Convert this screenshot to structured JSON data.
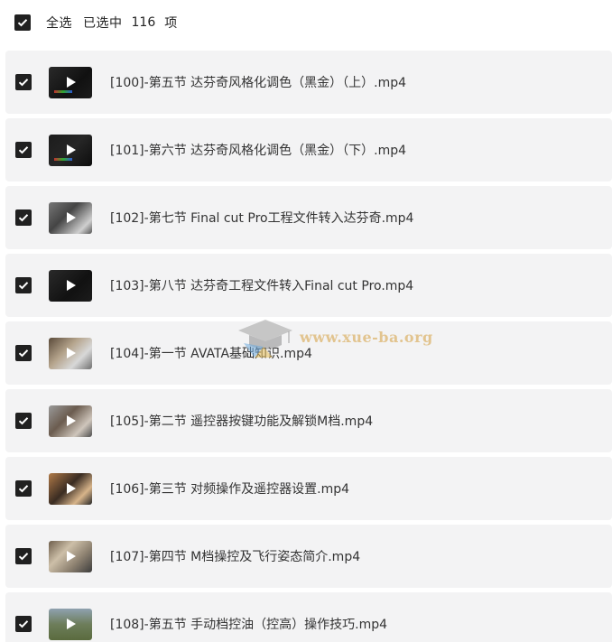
{
  "header": {
    "select_all_label": "全选",
    "selected_text": "已选中",
    "selected_count": "116",
    "selected_unit": "项",
    "select_all_checked": true
  },
  "files": [
    {
      "name": "[100]-第五节 达芬奇风格化调色（黑金）（上）.mp4",
      "checked": true,
      "thumb": "dark-ui"
    },
    {
      "name": "[101]-第六节 达芬奇风格化调色（黑金）（下）.mp4",
      "checked": true,
      "thumb": "dark-ui"
    },
    {
      "name": "[102]-第七节 Final cut Pro工程文件转入达芬奇.mp4",
      "checked": true,
      "thumb": "bw-studio"
    },
    {
      "name": "[103]-第八节 达芬奇工程文件转入Final cut Pro.mp4",
      "checked": true,
      "thumb": "dark-ui"
    },
    {
      "name": "[104]-第一节 AVATA基础知识.mp4",
      "checked": true,
      "thumb": "photo-person"
    },
    {
      "name": "[105]-第二节 遥控器按键功能及解锁M档.mp4",
      "checked": true,
      "thumb": "photo-hands"
    },
    {
      "name": "[106]-第三节 对频操作及遥控器设置.mp4",
      "checked": true,
      "thumb": "photo-hands"
    },
    {
      "name": "[107]-第四节 M档操控及飞行姿态简介.mp4",
      "checked": true,
      "thumb": "photo-hands"
    },
    {
      "name": "[108]-第五节 手动档控油（控高）操作技巧.mp4",
      "checked": true,
      "thumb": "photo-outdoor"
    }
  ],
  "watermark": {
    "text": "www.xue-ba.org",
    "icon": "graduation-cap-icon"
  },
  "colors": {
    "checkbox": "#202020",
    "row_background": "#f3f3f4",
    "text": "#333333",
    "watermark": "#dcb46e"
  }
}
